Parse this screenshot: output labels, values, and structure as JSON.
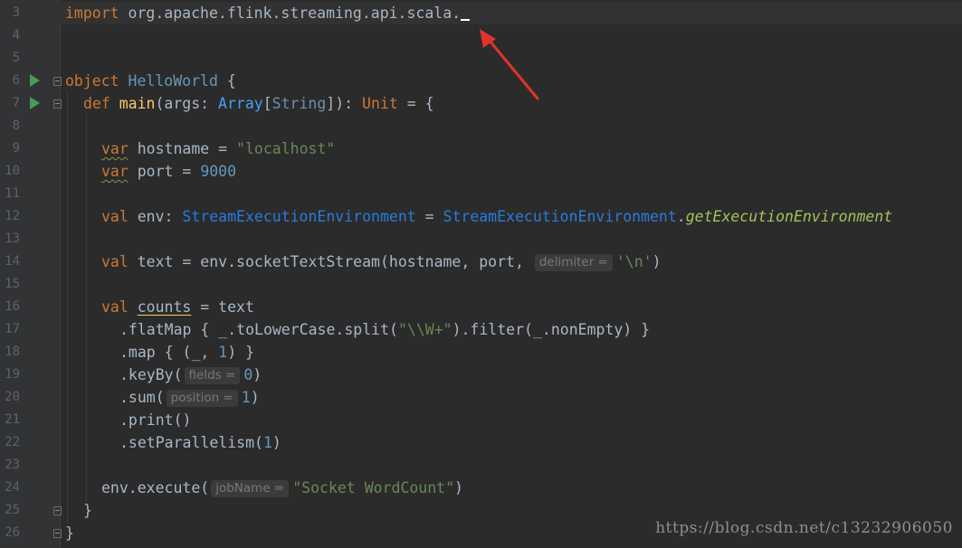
{
  "lines": [
    {
      "n": "3"
    },
    {
      "n": "4"
    },
    {
      "n": "5"
    },
    {
      "n": "6"
    },
    {
      "n": "7"
    },
    {
      "n": "8"
    },
    {
      "n": "9"
    },
    {
      "n": "10"
    },
    {
      "n": "11"
    },
    {
      "n": "12"
    },
    {
      "n": "13"
    },
    {
      "n": "14"
    },
    {
      "n": "15"
    },
    {
      "n": "16"
    },
    {
      "n": "17"
    },
    {
      "n": "18"
    },
    {
      "n": "19"
    },
    {
      "n": "20"
    },
    {
      "n": "21"
    },
    {
      "n": "22"
    },
    {
      "n": "23"
    },
    {
      "n": "24"
    },
    {
      "n": "25"
    },
    {
      "n": "26"
    }
  ],
  "code": {
    "l3_import": "import",
    "l3_pkg": " org.apache.flink.streaming.api.scala.",
    "l6_object": "object",
    "l6_name": "HelloWorld",
    "l6_brace": " {",
    "l7_def": "def",
    "l7_main": "main",
    "l7_args": "(args: ",
    "l7_array": "Array",
    "l7_lb": "[",
    "l7_string": "String",
    "l7_rb": "]): ",
    "l7_unit": "Unit",
    "l7_end": " = {",
    "l9_var": "var",
    "l9_name": "hostname",
    "l9_eq": " = ",
    "l9_str": "\"localhost\"",
    "l10_var": "var",
    "l10_name": "port",
    "l10_eq": " = ",
    "l10_num": "9000",
    "l12_val": "val",
    "l12_env": " env: ",
    "l12_type": "StreamExecutionEnvironment",
    "l12_eq": " = ",
    "l12_obj": "StreamExecutionEnvironment",
    "l12_dot": ".",
    "l12_call": "getExecutionEnvironment",
    "l14_val": "val",
    "l14_text": " text = env.socketTextStream(hostname, port, ",
    "l14_hint": "delimiter =",
    "l14_str": "'\\n'",
    "l14_end": ")",
    "l16_val": "val",
    "l16_counts": "counts",
    "l16_rest": " = text",
    "l17": ".flatMap { _.toLowerCase.split(",
    "l17_str": "\"\\\\W+\"",
    "l17_rest": ").filter(_.nonEmpty) }",
    "l18": ".map { (_, ",
    "l18_num": "1",
    "l18_end": ") }",
    "l19": ".keyBy(",
    "l19_hint": "fields =",
    "l19_num": "0",
    "l19_end": ")",
    "l20": ".sum(",
    "l20_hint": "position =",
    "l20_num": "1",
    "l20_end": ")",
    "l21": ".print()",
    "l22": ".setParallelism(",
    "l22_num": "1",
    "l22_end": ")",
    "l24": "env.execute(",
    "l24_hint": "jobName =",
    "l24_str": "\"Socket WordCount\"",
    "l24_end": ")",
    "l25": "}",
    "l26": "}"
  },
  "watermark": "https://blog.csdn.net/c13232906050",
  "colors": {
    "background": "#2b2b2b",
    "gutter": "#313335",
    "keyword": "#cc7832",
    "string": "#6a8759",
    "number": "#6897bb",
    "function": "#ffc66d",
    "run_icon": "#499c54",
    "arrow": "#e0332b"
  },
  "icons": [
    "run-icon",
    "fold-icon",
    "annotation-arrow"
  ]
}
